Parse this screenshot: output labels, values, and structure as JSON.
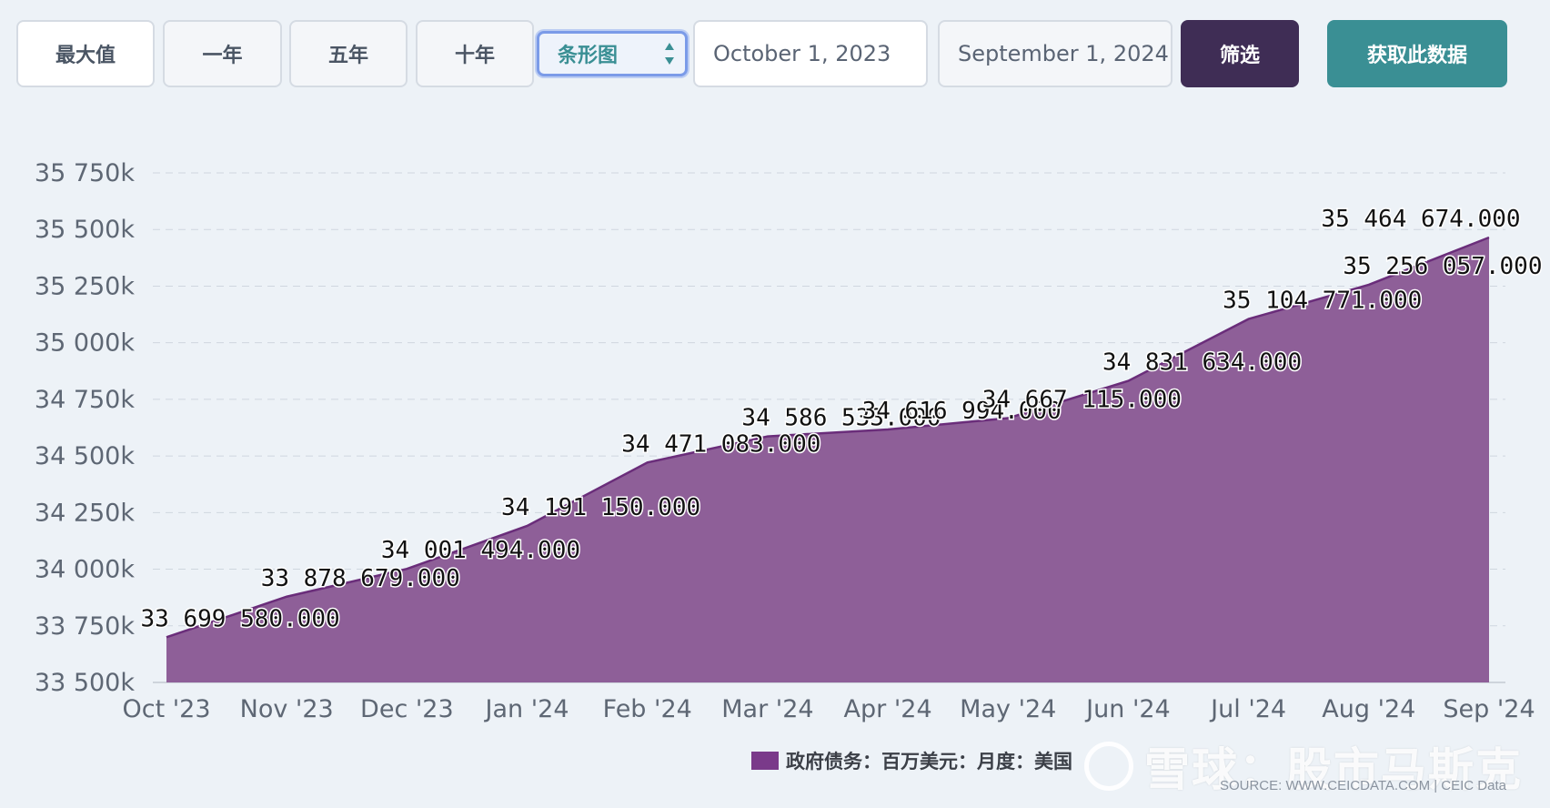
{
  "toolbar": {
    "range_buttons": [
      "最大值",
      "一年",
      "五年",
      "十年"
    ],
    "chart_type_select": "条形图",
    "start_date": "October 1, 2023",
    "end_date": "September 1, 2024",
    "filter_label": "筛选",
    "get_data_label": "获取此数据"
  },
  "colors": {
    "area_fill": "#8e5f98",
    "area_line": "#6a2d7a",
    "legend_swatch": "#7a3a8a",
    "filter_button": "#3f2d55",
    "get_data_button": "#3a8f94"
  },
  "chart_data": {
    "type": "area",
    "categories": [
      "Oct '23",
      "Nov '23",
      "Dec '23",
      "Jan '24",
      "Feb '24",
      "Mar '24",
      "Apr '24",
      "May '24",
      "Jun '24",
      "Jul '24",
      "Aug '24",
      "Sep '24"
    ],
    "series": [
      {
        "name": "政府债务：百万美元：月度：美国",
        "values": [
          33699580.0,
          33878679.0,
          34001494.0,
          34191150.0,
          34471083.0,
          34586533.0,
          34616994.0,
          34667115.0,
          34831634.0,
          35104771.0,
          35256057.0,
          35464674.0
        ],
        "labels": [
          "",
          "33 699 580.000",
          "33 878 679.000",
          "34 001 494.000",
          "34 191 150.000",
          "34 471 083.000",
          "34 586 533.000",
          "34 616 994.000",
          "34 667 115.000",
          "34 831 634.000",
          "35 104 771.000",
          "35 256 057.000"
        ]
      }
    ],
    "last_label": "35 464 674.000",
    "yticks": [
      33500000,
      33750000,
      34000000,
      34250000,
      34500000,
      34750000,
      35000000,
      35250000,
      35500000,
      35750000
    ],
    "ytick_labels": [
      "33 500k",
      "33 750k",
      "34 000k",
      "34 250k",
      "34 500k",
      "34 750k",
      "35 000k",
      "35 250k",
      "35 500k",
      "35 750k"
    ],
    "ylim": [
      33500000,
      35750000
    ],
    "grid": true,
    "legend": "bottom-right"
  },
  "watermark": "雪球：股市马斯克",
  "source": "SOURCE: WWW.CEICDATA.COM | CEIC Data"
}
